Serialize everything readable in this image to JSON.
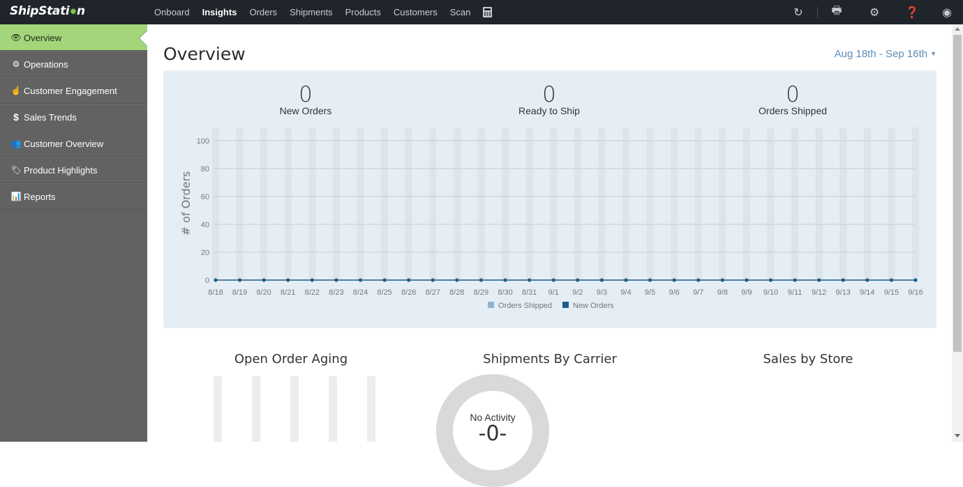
{
  "app": {
    "logo": "ShipStati",
    "logo_tail": "n"
  },
  "nav": {
    "items": [
      {
        "label": "Onboard",
        "active": false
      },
      {
        "label": "Insights",
        "active": true
      },
      {
        "label": "Orders",
        "active": false
      },
      {
        "label": "Shipments",
        "active": false
      },
      {
        "label": "Products",
        "active": false
      },
      {
        "label": "Customers",
        "active": false
      },
      {
        "label": "Scan",
        "active": false
      }
    ],
    "icons": [
      "calculator-icon",
      "refresh-icon",
      "printer-icon",
      "gear-icon",
      "help-icon",
      "user-icon"
    ]
  },
  "sidebar": {
    "items": [
      {
        "label": "Overview",
        "icon": "eye-icon",
        "active": true
      },
      {
        "label": "Operations",
        "icon": "cogs-icon",
        "active": false
      },
      {
        "label": "Customer Engagement",
        "icon": "hand-pointer-icon",
        "active": false
      },
      {
        "label": "Sales Trends",
        "icon": "dollar-icon",
        "active": false
      },
      {
        "label": "Customer Overview",
        "icon": "users-icon",
        "active": false
      },
      {
        "label": "Product Highlights",
        "icon": "tags-icon",
        "active": false
      },
      {
        "label": "Reports",
        "icon": "bar-chart-icon",
        "active": false
      }
    ]
  },
  "main": {
    "title": "Overview",
    "date_range": "Aug 18th - Sep 16th",
    "stats": [
      {
        "value": "0",
        "label": "New Orders"
      },
      {
        "value": "0",
        "label": "Ready to Ship"
      },
      {
        "value": "0",
        "label": "Orders Shipped"
      }
    ],
    "lower": {
      "open_order_aging_title": "Open Order Aging",
      "shipments_by_carrier_title": "Shipments By Carrier",
      "sales_by_store_title": "Sales by Store",
      "donut_label": "No Activity",
      "donut_value": "-0-"
    }
  },
  "colors": {
    "accent_green": "#a4d57b",
    "orders_shipped": "#8fb3d1",
    "new_orders": "#1f5f8b",
    "link_blue": "#5b8db8"
  },
  "chart_data": {
    "type": "bar",
    "title": "",
    "xlabel": "",
    "ylabel": "# of Orders",
    "ylim": [
      0,
      100
    ],
    "yticks": [
      0,
      20,
      40,
      60,
      80,
      100
    ],
    "grid": true,
    "legend_position": "bottom",
    "categories": [
      "8/18",
      "8/19",
      "8/20",
      "8/21",
      "8/22",
      "8/23",
      "8/24",
      "8/25",
      "8/26",
      "8/27",
      "8/28",
      "8/29",
      "8/30",
      "8/31",
      "9/1",
      "9/2",
      "9/3",
      "9/4",
      "9/5",
      "9/6",
      "9/7",
      "9/8",
      "9/9",
      "9/10",
      "9/11",
      "9/12",
      "9/13",
      "9/14",
      "9/15",
      "9/16"
    ],
    "series": [
      {
        "name": "Orders Shipped",
        "type": "bar",
        "color": "#8fb3d1",
        "values": [
          0,
          0,
          0,
          0,
          0,
          0,
          0,
          0,
          0,
          0,
          0,
          0,
          0,
          0,
          0,
          0,
          0,
          0,
          0,
          0,
          0,
          0,
          0,
          0,
          0,
          0,
          0,
          0,
          0,
          0
        ]
      },
      {
        "name": "New Orders",
        "type": "line",
        "color": "#1f5f8b",
        "values": [
          0,
          0,
          0,
          0,
          0,
          0,
          0,
          0,
          0,
          0,
          0,
          0,
          0,
          0,
          0,
          0,
          0,
          0,
          0,
          0,
          0,
          0,
          0,
          0,
          0,
          0,
          0,
          0,
          0,
          0
        ]
      }
    ]
  }
}
